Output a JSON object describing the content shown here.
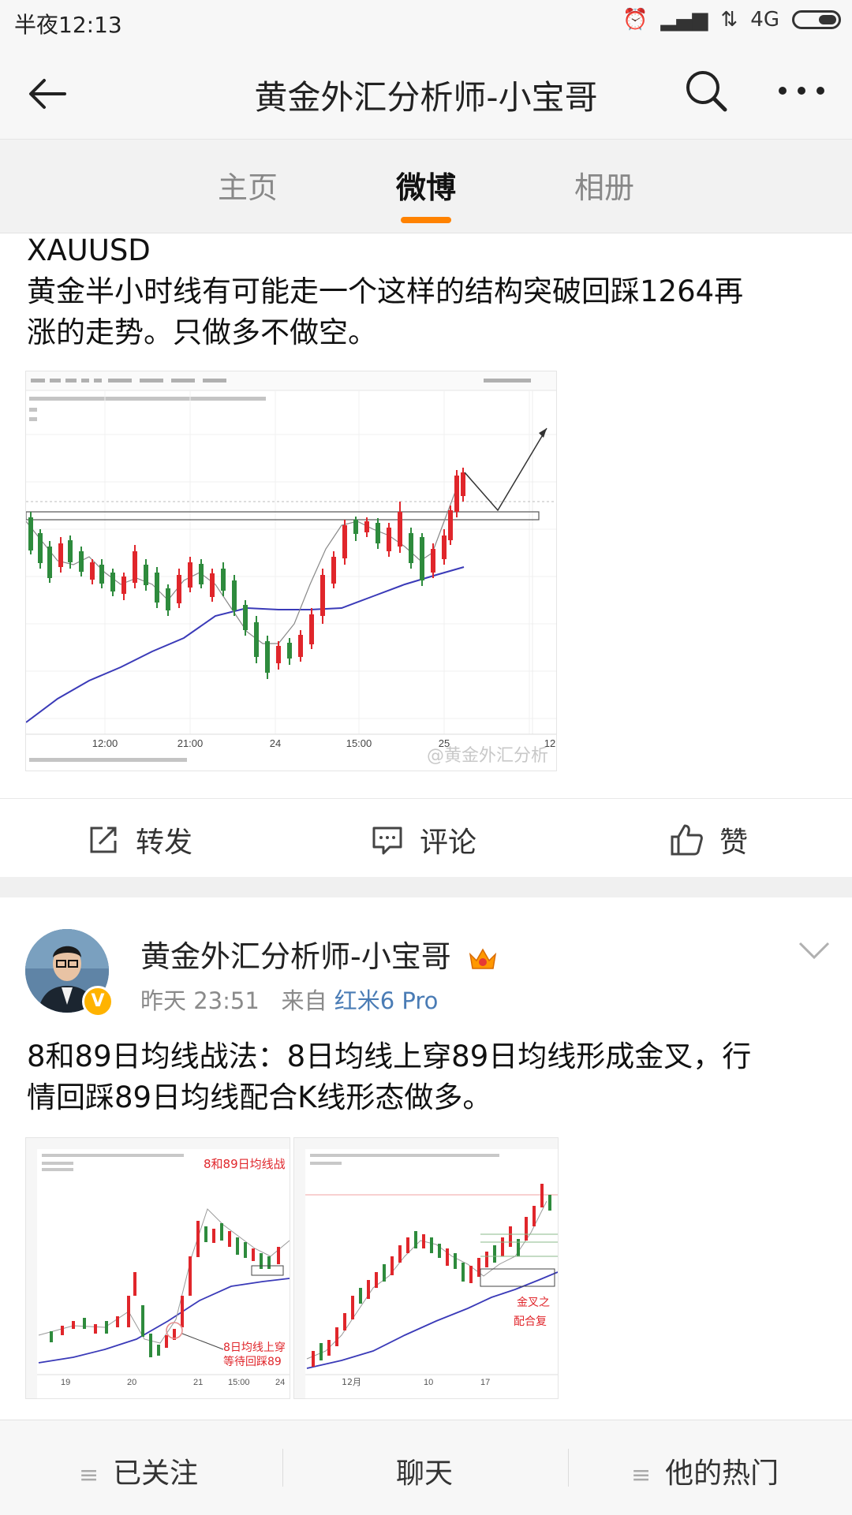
{
  "status": {
    "time": "半夜12:13",
    "network": "4G"
  },
  "header": {
    "title": "黄金外汇分析师-小宝哥"
  },
  "tabs": [
    {
      "label": "主页"
    },
    {
      "label": "微博"
    },
    {
      "label": "相册"
    }
  ],
  "post1": {
    "text_line1": "XAUUSD",
    "text_line2": "黄金半小时线有可能走一个这样的结构突破回踩1264再",
    "text_line3": "涨的走势。只做多不做空。",
    "chart": {
      "x_ticks": [
        "12:00",
        "21:00",
        "24",
        "15:00",
        "25",
        "12"
      ],
      "watermark": "@黄金外汇分析"
    }
  },
  "actions": {
    "repost": "转发",
    "comment": "评论",
    "like": "赞"
  },
  "post2": {
    "author": "黄金外汇分析师-小宝哥",
    "time": "昨天 23:51",
    "source_prefix": "来自",
    "source": "红米6 Pro",
    "text_line1": "8和89日均线战法：8日均线上穿89日均线形成金叉，行",
    "text_line2": "情回踩89日均线配合K线形态做多。",
    "img1": {
      "title": "8和89日均线战",
      "note_line1": "8日均线上穿",
      "note_line2": "等待回踩89",
      "x_ticks": [
        "19",
        "20",
        "21",
        "15:00",
        "24"
      ]
    },
    "img2": {
      "note_line1": "金叉之",
      "note_line2": "配合复",
      "x_ticks": [
        "12月",
        "10",
        "17"
      ]
    }
  },
  "bottom": {
    "following": "已关注",
    "chat": "聊天",
    "hot": "他的热门"
  },
  "colors": {
    "accent": "#ff8200",
    "link": "#4a7cb5",
    "bull": "#e0262b",
    "bear": "#2e8b3d",
    "ma": "#3a3ab8"
  }
}
